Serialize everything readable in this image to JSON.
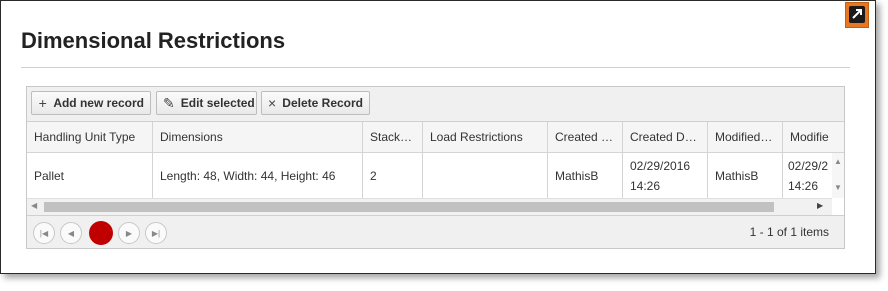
{
  "page": {
    "title": "Dimensional Restrictions"
  },
  "toolbar": {
    "add_label": "Add new record",
    "edit_label": "Edit selected",
    "delete_label": "Delete Record",
    "add_icon": "plus-icon",
    "edit_icon": "pencil-icon",
    "delete_icon": "x-icon"
  },
  "grid": {
    "columns": [
      "Handling Unit Type",
      "Dimensions",
      "Stack…",
      "Load Restrictions",
      "Created …",
      "Created D…",
      "Modified…",
      "Modifie"
    ],
    "rows": [
      {
        "handling_unit_type": "Pallet",
        "dimensions": "Length: 48, Width: 44, Height: 46",
        "stackable": "2",
        "load_restrictions": "",
        "created_by": "MathisB",
        "created_date": "02/29/2016 14:26",
        "modified_by": "MathisB",
        "modified_date": "02/29/2 14:26"
      }
    ]
  },
  "pager": {
    "current_page": "1",
    "info": "1 - 1 of 1 items"
  },
  "colors": {
    "accent_orange": "#e87722",
    "current_page_red": "#c00000"
  }
}
